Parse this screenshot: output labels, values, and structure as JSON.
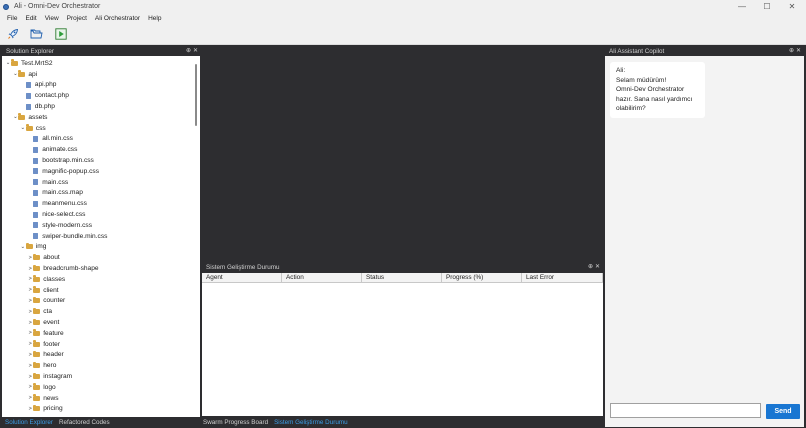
{
  "window": {
    "title": "Ali - Omni-Dev Orchestrator",
    "minimize": "—",
    "maximize": "☐",
    "close": "✕"
  },
  "menu": [
    "File",
    "Edit",
    "View",
    "Project",
    "Ali Orchestrator",
    "Help"
  ],
  "toolbar": {
    "icons": [
      "rocket-icon",
      "open-folder-icon",
      "run-icon"
    ]
  },
  "solution_explorer": {
    "title": "Solution Explorer",
    "pin": "⊕",
    "close": "✕",
    "tree": [
      {
        "label": "Test.MrtS2",
        "type": "folder",
        "level": 0,
        "state": "open"
      },
      {
        "label": "api",
        "type": "folder",
        "level": 1,
        "state": "open"
      },
      {
        "label": "api.php",
        "type": "file",
        "level": 2
      },
      {
        "label": "contact.php",
        "type": "file",
        "level": 2
      },
      {
        "label": "db.php",
        "type": "file",
        "level": 2
      },
      {
        "label": "assets",
        "type": "folder",
        "level": 1,
        "state": "open"
      },
      {
        "label": "css",
        "type": "folder",
        "level": 2,
        "state": "open"
      },
      {
        "label": "all.min.css",
        "type": "file",
        "level": 3
      },
      {
        "label": "animate.css",
        "type": "file",
        "level": 3
      },
      {
        "label": "bootstrap.min.css",
        "type": "file",
        "level": 3
      },
      {
        "label": "magnific-popup.css",
        "type": "file",
        "level": 3
      },
      {
        "label": "main.css",
        "type": "file",
        "level": 3
      },
      {
        "label": "main.css.map",
        "type": "file",
        "level": 3
      },
      {
        "label": "meanmenu.css",
        "type": "file",
        "level": 3
      },
      {
        "label": "nice-select.css",
        "type": "file",
        "level": 3
      },
      {
        "label": "style-modern.css",
        "type": "file",
        "level": 3
      },
      {
        "label": "swiper-bundle.min.css",
        "type": "file",
        "level": 3
      },
      {
        "label": "img",
        "type": "folder",
        "level": 2,
        "state": "open"
      },
      {
        "label": "about",
        "type": "folder",
        "level": 3,
        "state": "closed"
      },
      {
        "label": "breadcrumb-shape",
        "type": "folder",
        "level": 3,
        "state": "closed"
      },
      {
        "label": "classes",
        "type": "folder",
        "level": 3,
        "state": "closed"
      },
      {
        "label": "client",
        "type": "folder",
        "level": 3,
        "state": "closed"
      },
      {
        "label": "counter",
        "type": "folder",
        "level": 3,
        "state": "closed"
      },
      {
        "label": "cta",
        "type": "folder",
        "level": 3,
        "state": "closed"
      },
      {
        "label": "event",
        "type": "folder",
        "level": 3,
        "state": "closed"
      },
      {
        "label": "feature",
        "type": "folder",
        "level": 3,
        "state": "closed"
      },
      {
        "label": "footer",
        "type": "folder",
        "level": 3,
        "state": "closed"
      },
      {
        "label": "header",
        "type": "folder",
        "level": 3,
        "state": "closed"
      },
      {
        "label": "hero",
        "type": "folder",
        "level": 3,
        "state": "closed"
      },
      {
        "label": "instagram",
        "type": "folder",
        "level": 3,
        "state": "closed"
      },
      {
        "label": "logo",
        "type": "folder",
        "level": 3,
        "state": "closed"
      },
      {
        "label": "news",
        "type": "folder",
        "level": 3,
        "state": "closed"
      },
      {
        "label": "pricing",
        "type": "folder",
        "level": 3,
        "state": "closed"
      }
    ]
  },
  "left_tabs": [
    {
      "label": "Solution Explorer",
      "active": true
    },
    {
      "label": "Refactored Codes",
      "active": false
    }
  ],
  "status_panel": {
    "title": "Sistem Geliştirme Durumu",
    "pin": "⊕",
    "close": "✕",
    "columns": [
      "Agent",
      "Action",
      "Status",
      "Progress (%)",
      "Last Error"
    ]
  },
  "middle_tabs": [
    {
      "label": "Swarm Progress Board",
      "active": false
    },
    {
      "label": "Sistem Geliştirme Durumu",
      "active": true
    }
  ],
  "assistant": {
    "title": "Ali Assistant Copilot",
    "pin": "⊕",
    "close": "✕",
    "messages": [
      {
        "sender": "Ali:",
        "lines": [
          "Selam müdürüm!",
          "Omni-Dev Orchestrator",
          "hazır. Sana nasıl yardımcı",
          "olabilirim?"
        ]
      }
    ],
    "input_value": "",
    "send_label": "Send"
  },
  "colors": {
    "accent": "#1976d2",
    "active_tab": "#3c9ee8",
    "folder": "#d9a640",
    "file": "#6d8fc7",
    "dark_bg": "#2d2d30"
  }
}
